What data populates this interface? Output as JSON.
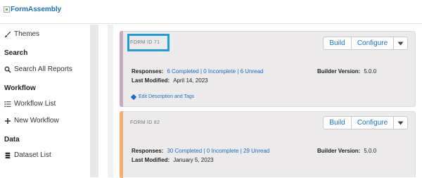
{
  "header": {
    "logo_alt": "FormAssembly"
  },
  "sidebar": {
    "themes_label": "Themes",
    "search_heading": "Search",
    "search_all_label": "Search All Reports",
    "workflow_heading": "Workflow",
    "workflow_list_label": "Workflow List",
    "new_workflow_label": "New Workflow",
    "data_heading": "Data",
    "dataset_list_label": "Dataset List"
  },
  "forms": [
    {
      "id_label": "FORM ID 71",
      "stripe_color": "#c9a9c4",
      "build_label": "Build",
      "configure_label": "Configure",
      "responses_label": "Responses:",
      "responses_value": "6 Completed | 0 Incomplete | 6 Unread",
      "last_modified_label": "Last Modified:",
      "last_modified_value": "April 14, 2023",
      "builder_version_label": "Builder Version:",
      "builder_version_value": "5.0.0",
      "edit_link_label": "Edit Description and Tags"
    },
    {
      "id_label": "FORM ID 82",
      "stripe_color": "#f5ad6b",
      "build_label": "Build",
      "configure_label": "Configure",
      "responses_label": "Responses:",
      "responses_value": "30 Completed | 0 Incomplete | 29 Unread",
      "last_modified_label": "Last Modified:",
      "last_modified_value": "January 5, 2023",
      "builder_version_label": "Builder Version:",
      "builder_version_value": "5.0.0"
    }
  ],
  "colors": {
    "accent": "#1a6fc4",
    "highlight": "#1e9fd6"
  }
}
